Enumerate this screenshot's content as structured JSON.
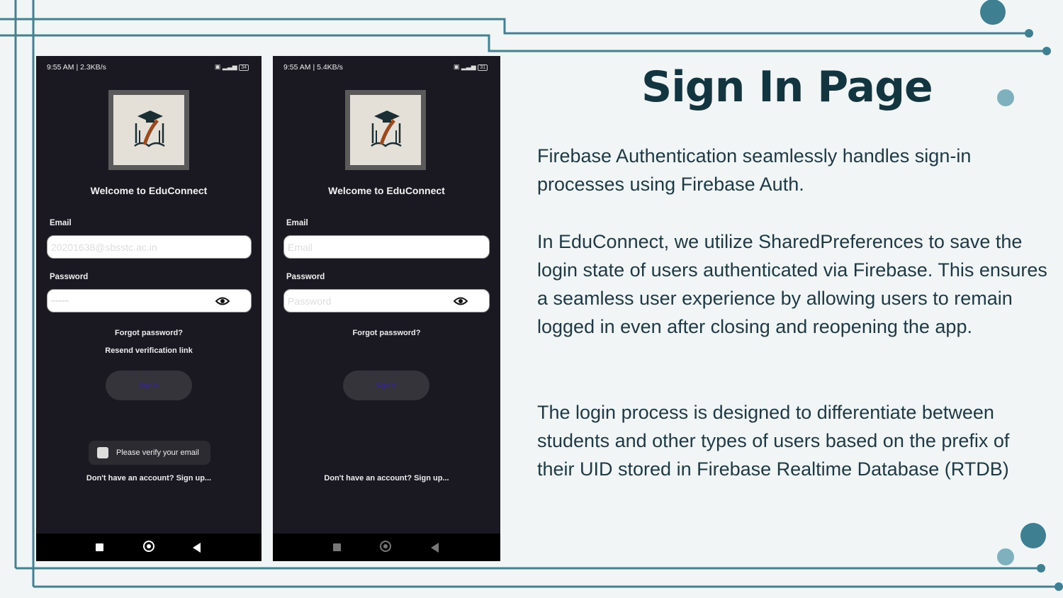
{
  "slide": {
    "title": "Sign In Page",
    "paragraphs": [
      "Firebase Authentication seamlessly handles sign-in processes using Firebase Auth.",
      "In EduConnect, we utilize SharedPreferences to save the login state of users authenticated via Firebase. This ensures a seamless user experience by allowing users to remain logged in even after closing and reopening the app.",
      "The login process is designed to differentiate between students and other types of users based on the prefix of their UID stored in Firebase Realtime Database (RTDB)"
    ]
  },
  "phone1": {
    "status_time": "9:55 AM | 2.3KB/s",
    "battery": "34",
    "welcome": "Welcome to EduConnect",
    "email_label": "Email",
    "email_value": "20201638@sbsstc.ac.in",
    "password_label": "Password",
    "password_value": "••••••••",
    "forgot": "Forgot password?",
    "resend": "Resend verification link",
    "sign_in": "Sign In",
    "toast": "Please verify your email",
    "signup": "Don't have an account? Sign up..."
  },
  "phone2": {
    "status_time": "9:55 AM | 5.4KB/s",
    "battery": "31",
    "welcome": "Welcome to EduConnect",
    "email_label": "Email",
    "email_placeholder": "Email",
    "password_label": "Password",
    "password_placeholder": "Password",
    "forgot": "Forgot password?",
    "sign_in": "Sign In",
    "signup": "Don't have an account? Sign up..."
  },
  "colors": {
    "accent": "#3f7f92",
    "accent_light": "#7fb0bd",
    "title": "#133540",
    "phone_bg": "#1a1821"
  },
  "icons": [
    "logo-icon",
    "eye-icon",
    "toast-app-icon",
    "recent-apps-icon",
    "home-icon",
    "back-icon",
    "wifi-icon",
    "signal-icon",
    "battery-icon"
  ]
}
